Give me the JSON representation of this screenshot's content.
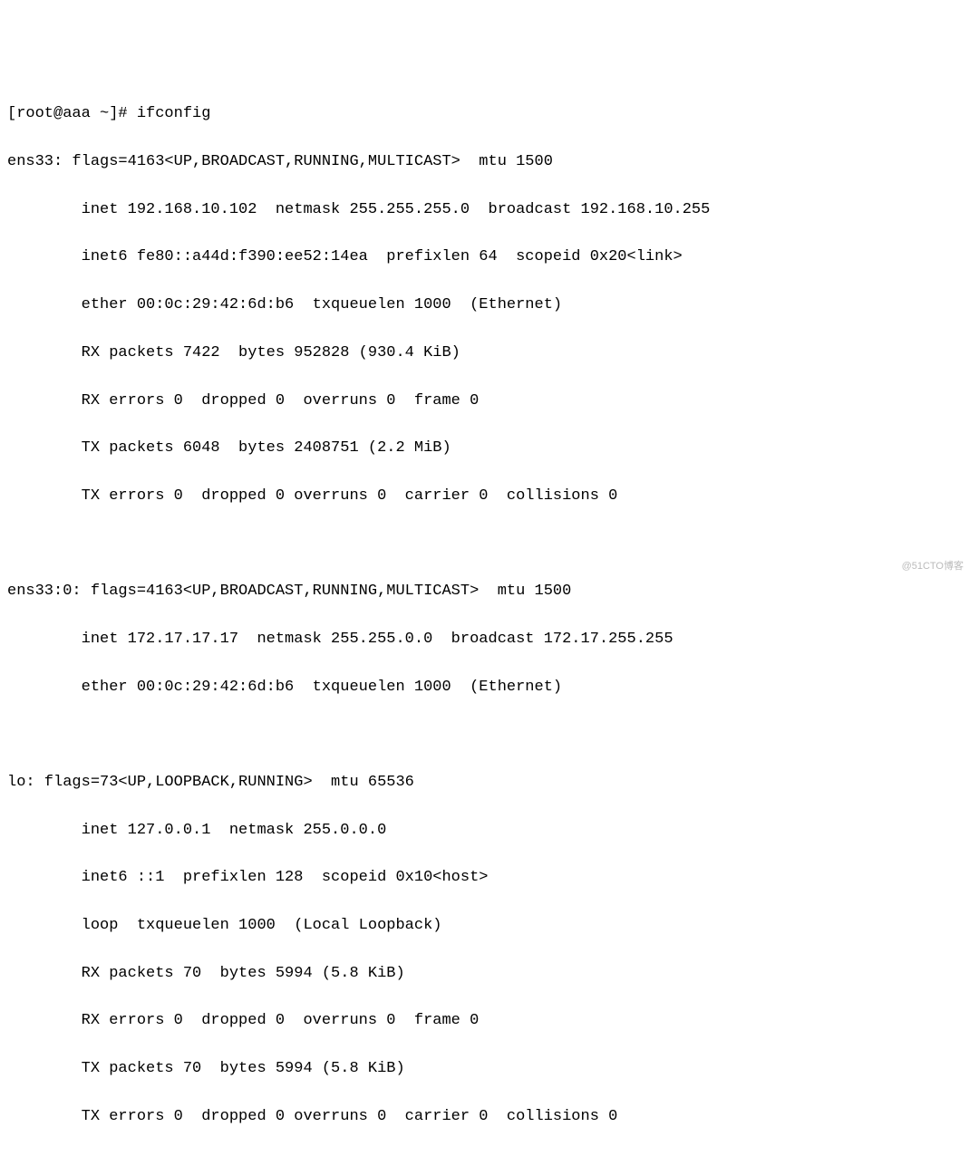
{
  "prompt": "[root@aaa ~]# ifconfig",
  "ens33": {
    "header": "ens33: flags=4163<UP,BROADCAST,RUNNING,MULTICAST>  mtu 1500",
    "inet": "        inet 192.168.10.102  netmask 255.255.255.0  broadcast 192.168.10.255",
    "inet6": "        inet6 fe80::a44d:f390:ee52:14ea  prefixlen 64  scopeid 0x20<link>",
    "ether": "        ether 00:0c:29:42:6d:b6  txqueuelen 1000  (Ethernet)",
    "rxp": "        RX packets 7422  bytes 952828 (930.4 KiB)",
    "rxe": "        RX errors 0  dropped 0  overruns 0  frame 0",
    "txp": "        TX packets 6048  bytes 2408751 (2.2 MiB)",
    "txe": "        TX errors 0  dropped 0 overruns 0  carrier 0  collisions 0"
  },
  "ens33_0": {
    "header": "ens33:0: flags=4163<UP,BROADCAST,RUNNING,MULTICAST>  mtu 1500",
    "inet": "        inet 172.17.17.17  netmask 255.255.0.0  broadcast 172.17.255.255",
    "ether": "        ether 00:0c:29:42:6d:b6  txqueuelen 1000  (Ethernet)"
  },
  "lo": {
    "header": "lo: flags=73<UP,LOOPBACK,RUNNING>  mtu 65536",
    "inet": "        inet 127.0.0.1  netmask 255.0.0.0",
    "inet6": "        inet6 ::1  prefixlen 128  scopeid 0x10<host>",
    "loop": "        loop  txqueuelen 1000  (Local Loopback)",
    "rxp": "        RX packets 70  bytes 5994 (5.8 KiB)",
    "rxe": "        RX errors 0  dropped 0  overruns 0  frame 0",
    "txp": "        TX packets 70  bytes 5994 (5.8 KiB)",
    "txe": "        TX errors 0  dropped 0 overruns 0  carrier 0  collisions 0"
  },
  "blank": " ",
  "watermark": "@51CTO博客"
}
